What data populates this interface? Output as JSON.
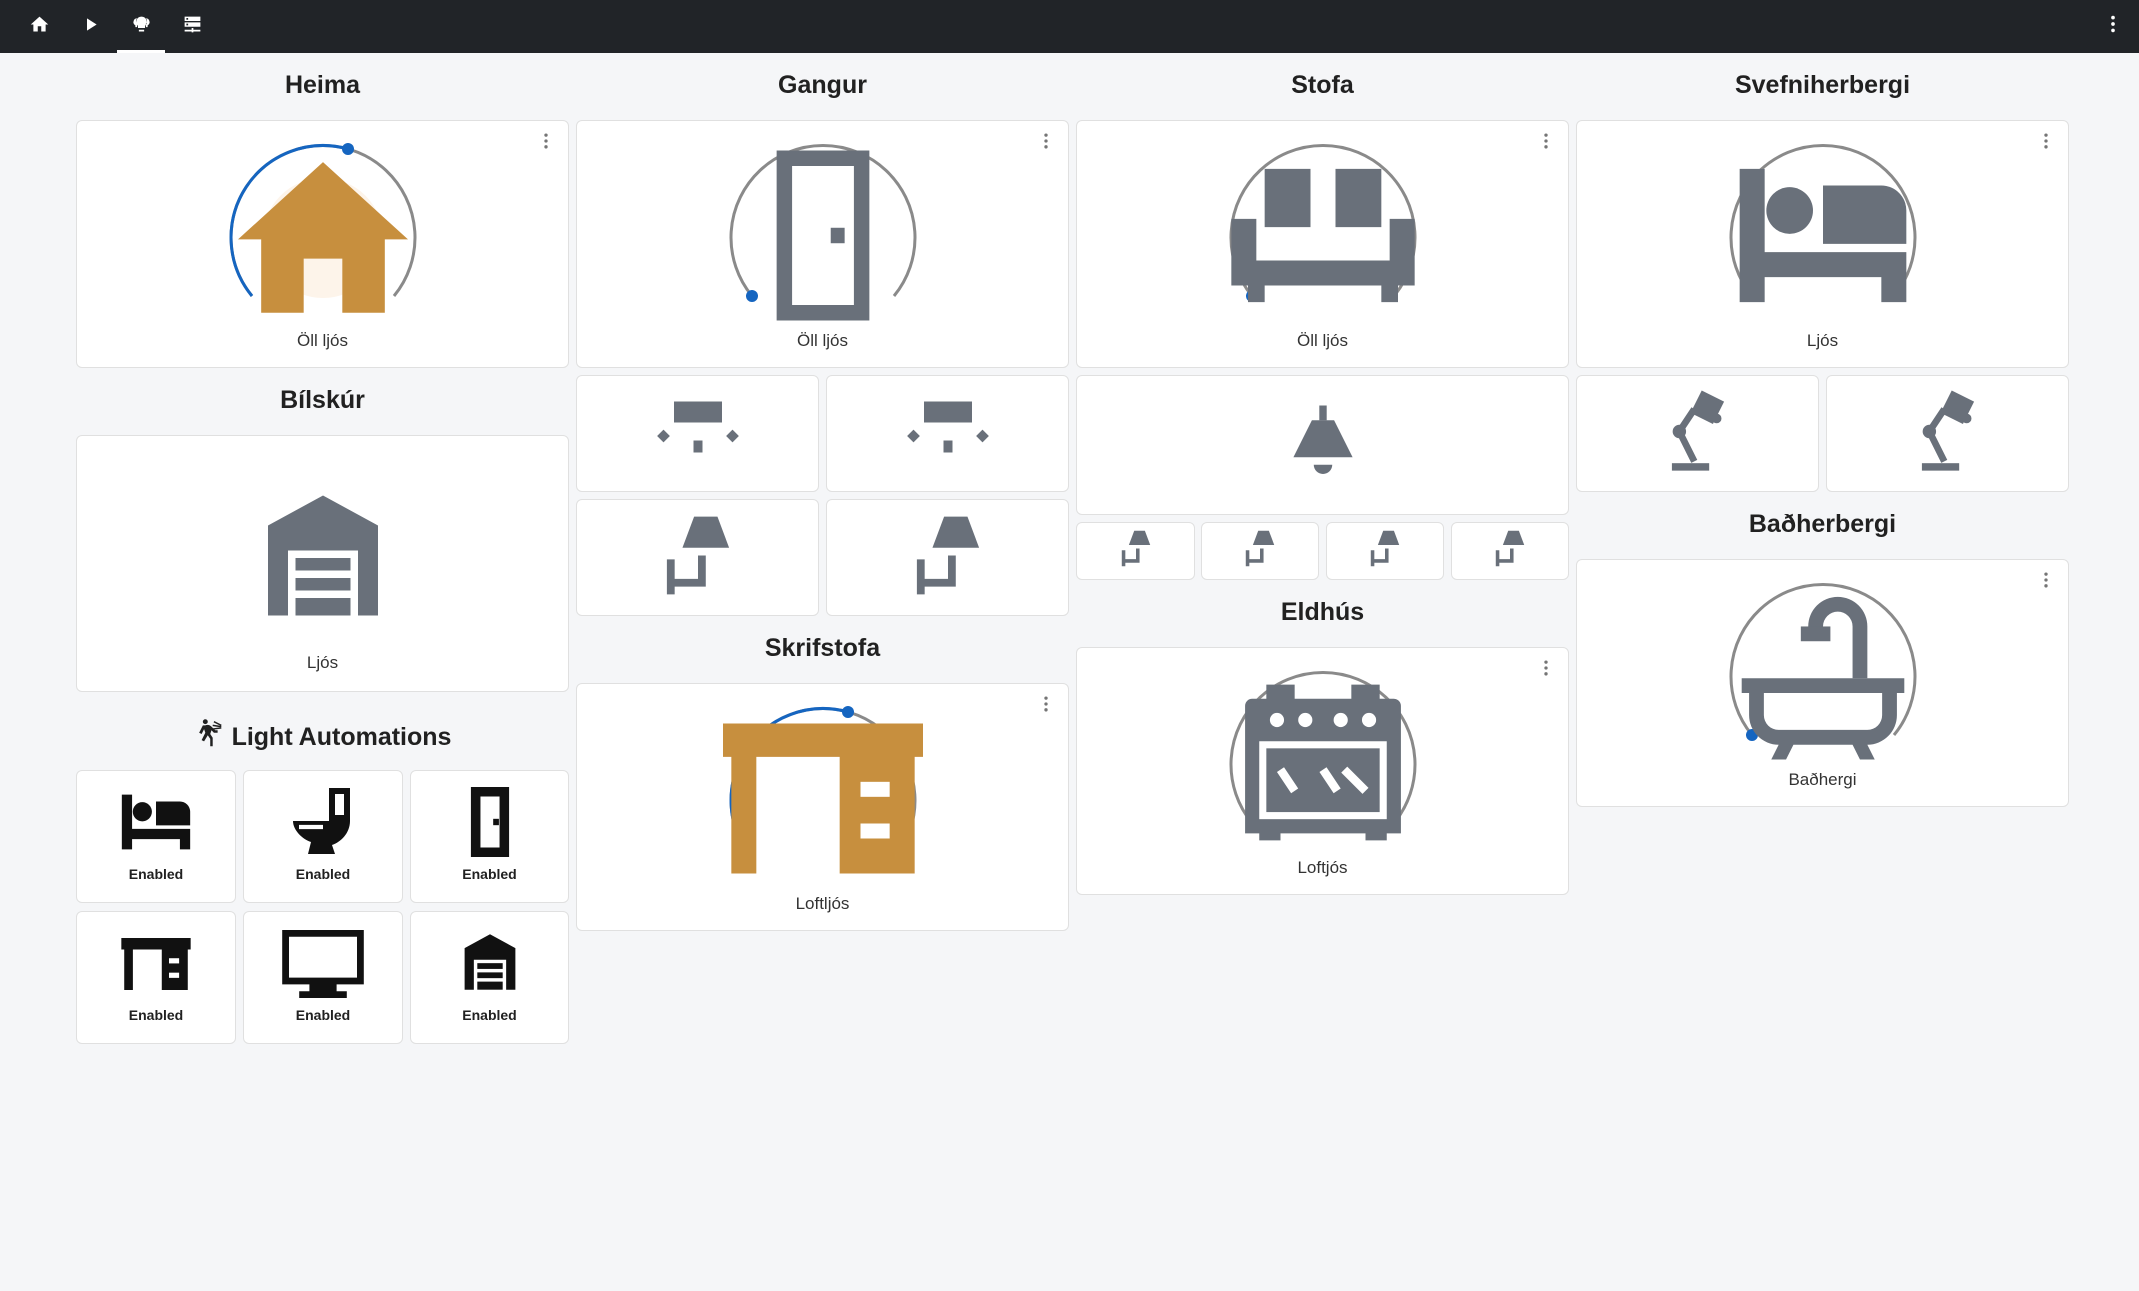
{
  "colors": {
    "topbar": "#212428",
    "accent": "#1565c0",
    "dial_track": "#8a8a8a",
    "icon_on": "#c78f3e",
    "icon_off": "#69707a"
  },
  "toolbar": {
    "tabs": [
      "home-icon",
      "play-icon",
      "lightbulb-group-icon",
      "server-icon"
    ],
    "active_tab_index": 2,
    "menu_icon": "dots-vertical-icon"
  },
  "sections": {
    "heima": {
      "title": "Heima",
      "card": {
        "label": "Öll ljós",
        "icon": "home-icon",
        "on": true,
        "brightness_pct": 65
      }
    },
    "gangur": {
      "title": "Gangur",
      "card": {
        "label": "Öll ljós",
        "icon": "door-icon",
        "on": false,
        "brightness_pct": 0
      },
      "buttons": [
        "ceiling-light-icon",
        "ceiling-light-icon",
        "wall-sconce-icon",
        "wall-sconce-icon"
      ]
    },
    "stofa": {
      "title": "Stofa",
      "card": {
        "label": "Öll ljós",
        "icon": "sofa-icon",
        "on": false,
        "brightness_pct": 0
      },
      "buttons": [
        "pendant-lamp-icon"
      ],
      "small_buttons": [
        "wall-sconce-icon",
        "wall-sconce-icon",
        "wall-sconce-icon",
        "wall-sconce-icon"
      ]
    },
    "svefniherbergi": {
      "title": "Svefniherbergi",
      "card": {
        "label": "Ljós",
        "icon": "bed-icon",
        "on": false,
        "brightness_pct": 0
      },
      "buttons": [
        "desk-lamp-icon",
        "desk-lamp-icon"
      ]
    },
    "bilskur": {
      "title": "Bílskúr",
      "card": {
        "label": "Ljós",
        "icon": "garage-icon"
      }
    },
    "skrifstofa": {
      "title": "Skrifstofa",
      "card": {
        "label": "Loftljós",
        "icon": "desk-icon",
        "on": true,
        "brightness_pct": 65
      }
    },
    "eldhus": {
      "title": "Eldhús",
      "card": {
        "label": "Loftjós",
        "icon": "stove-icon",
        "on": false,
        "brightness_pct": 0
      }
    },
    "badherbergi": {
      "title": "Baðherbergi",
      "card": {
        "label": "Baðhergi",
        "icon": "bathtub-icon",
        "on": false,
        "brightness_pct": 0
      }
    },
    "automations": {
      "title": "Light Automations",
      "title_icon": "motion-sensor-icon",
      "items": [
        {
          "icon": "bed-icon",
          "label": "Enabled"
        },
        {
          "icon": "toilet-icon",
          "label": "Enabled"
        },
        {
          "icon": "door-icon",
          "label": "Enabled"
        },
        {
          "icon": "desk-icon",
          "label": "Enabled"
        },
        {
          "icon": "monitor-icon",
          "label": "Enabled"
        },
        {
          "icon": "garage-icon",
          "label": "Enabled"
        }
      ]
    }
  }
}
